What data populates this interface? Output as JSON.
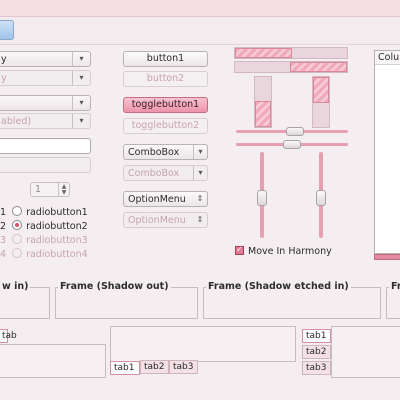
{
  "left": {
    "combo1_text": "y",
    "combo2_text": "y",
    "combo4_text": "abled)",
    "spin_value": "1",
    "radio_prefix_1": "1",
    "radio_prefix_2": "2",
    "radio_prefix_3": "3",
    "radio_prefix_4": "4",
    "radio1": "radiobutton1",
    "radio2": "radiobutton2",
    "radio3": "radiobutton3",
    "radio4": "radiobutton4"
  },
  "middle": {
    "button1": "button1",
    "button2": "button2",
    "togglebutton1": "togglebutton1",
    "togglebutton2": "togglebutton2",
    "combobox1": "ComboBox",
    "combobox2": "ComboBox",
    "optionmenu1": "OptionMenu",
    "optionmenu2": "OptionMenu"
  },
  "right": {
    "move_in_harmony": "Move In Harmony",
    "list_column": "Colu"
  },
  "frames": {
    "f0": "w in)",
    "f1": "Frame (Shadow out)",
    "f2": "Frame (Shadow etched in)",
    "f3": "Fr"
  },
  "tabs": {
    "left_top": "tab",
    "bottom": [
      "tab1",
      "tab2",
      "tab3"
    ],
    "right": [
      "tab1",
      "tab2",
      "tab3"
    ]
  },
  "icons": {
    "dropdown": "▾",
    "spin_up": "▲",
    "spin_down": "▼",
    "updown": "⇕"
  }
}
